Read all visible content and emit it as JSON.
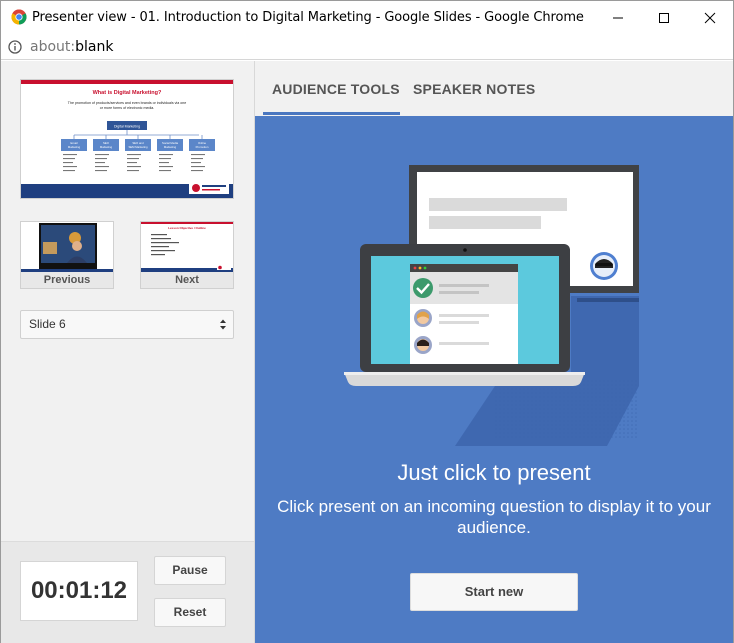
{
  "window": {
    "title": "Presenter view - 01. Introduction to Digital Marketing - Google Slides - Google Chrome"
  },
  "address": {
    "scheme": "about:",
    "path": "blank"
  },
  "slides": {
    "current": {
      "title": "What is Digital Marketing?",
      "subtitle": "The promotion of products/services and even brands or individuals via one or more forms of electronic media.",
      "root_box": "Digital Marketing",
      "boxes": [
        "Email Marketing",
        "SEO Marketing",
        "SEO and SEM Marketing",
        "Social Media Marketing",
        "Online Promotion"
      ]
    },
    "previous_label": "Previous",
    "next_label": "Next",
    "next_title": "Lesson Objective / Outline"
  },
  "slide_select": {
    "value": "Slide 6"
  },
  "timer": {
    "value": "00:01:12",
    "pause_label": "Pause",
    "reset_label": "Reset"
  },
  "tabs": [
    {
      "label": "AUDIENCE TOOLS",
      "active": true
    },
    {
      "label": "SPEAKER NOTES",
      "active": false
    }
  ],
  "audience": {
    "headline": "Just click to present",
    "description": "Click present on an incoming question to display it to your audience.",
    "start_label": "Start new"
  },
  "colors": {
    "accent_blue": "#4e7bc4",
    "tab_underline": "#4a77c0",
    "slide_red": "#c8102e",
    "slide_navy": "#1f3f80",
    "check_green": "#3c9a6c"
  }
}
